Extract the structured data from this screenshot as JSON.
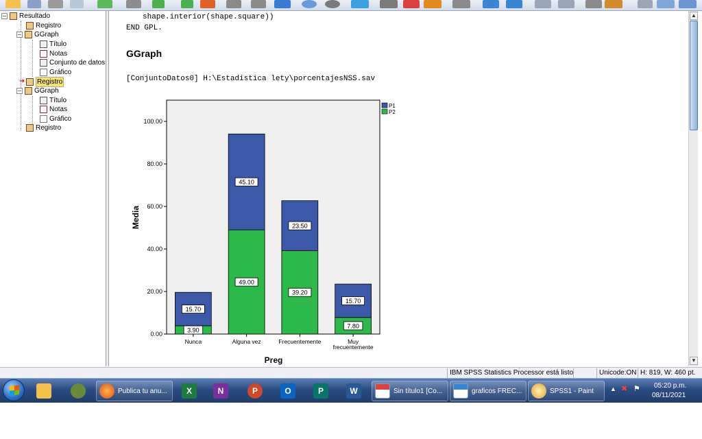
{
  "tree": {
    "items": [
      {
        "label": "Resultado",
        "icon": "output-book-icon",
        "expander": "−"
      },
      {
        "label": "Registro",
        "icon": "log-icon"
      },
      {
        "label": "GGraph",
        "icon": "ggraph-book-icon",
        "expander": "−"
      },
      {
        "label": "Título",
        "icon": "title-icon"
      },
      {
        "label": "Notas",
        "icon": "notes-icon"
      },
      {
        "label": "Conjunto de datos",
        "icon": "dataset-icon"
      },
      {
        "label": "Gráfico",
        "icon": "chart-icon"
      },
      {
        "label": "Registro",
        "icon": "log-icon",
        "selected": true
      },
      {
        "label": "GGraph",
        "icon": "ggraph-book-icon",
        "expander": "−"
      },
      {
        "label": "Título",
        "icon": "title-icon"
      },
      {
        "label": "Notas",
        "icon": "notes-icon"
      },
      {
        "label": "Gráfico",
        "icon": "chart-icon"
      },
      {
        "label": "Registro",
        "icon": "log-icon"
      }
    ]
  },
  "content": {
    "code_line1": "shape.interior(shape.square))",
    "code_line2": "END GPL.",
    "heading": "GGraph",
    "dataset_line": "[ConjuntoDatos0] H:\\Estadistica lety\\porcentajesNSS.sav"
  },
  "chart_data": {
    "type": "bar",
    "stacked": true,
    "categories": [
      "Nunca",
      "Alguna vez",
      "Frecuentemente",
      "Muy frecuentemente"
    ],
    "category_labels": [
      [
        "Nunca"
      ],
      [
        "Alguna vez"
      ],
      [
        "Frecuentemente"
      ],
      [
        "Muy",
        "frecuentemente"
      ]
    ],
    "series": [
      {
        "name": "P2",
        "values": [
          3.9,
          49.0,
          39.2,
          7.8
        ],
        "labels": [
          "3.90",
          "49.00",
          "39.20",
          "7.80"
        ],
        "color": "#2db84a"
      },
      {
        "name": "P1",
        "values": [
          15.7,
          45.1,
          23.5,
          15.7
        ],
        "labels": [
          "15.70",
          "45.10",
          "23.50",
          "15.70"
        ],
        "color": "#3c58a8"
      }
    ],
    "legend": [
      "P1",
      "P2"
    ],
    "legend_colors": [
      "#3c58a8",
      "#2db84a"
    ],
    "legend_placement": "top-right",
    "xlabel": "Preg",
    "ylabel": "Media",
    "ylim": [
      0,
      110
    ],
    "yticks": [
      0,
      20,
      40,
      60,
      80,
      100
    ],
    "ytick_labels": [
      "0.00",
      "20.00",
      "40.00",
      "60.00",
      "80.00",
      "100.00"
    ],
    "grid": false,
    "plot_background": "#efefef"
  },
  "status": {
    "processor": "IBM SPSS Statistics Processor está listo",
    "unicode": "Unicode:ON",
    "dims": "H: 819, W: 460 pt."
  },
  "taskbar": {
    "items": [
      {
        "label": "",
        "icon": "explorer-icon"
      },
      {
        "label": "",
        "icon": "media-icon"
      },
      {
        "label": "Publica tu anu...",
        "icon": "firefox-icon"
      },
      {
        "label": "",
        "icon": "excel-icon",
        "letter": "X"
      },
      {
        "label": "",
        "icon": "onenote-icon",
        "letter": "N"
      },
      {
        "label": "",
        "icon": "powerpoint-icon",
        "letter": "P"
      },
      {
        "label": "",
        "icon": "outlook-icon",
        "letter": "O"
      },
      {
        "label": "",
        "icon": "publisher-icon",
        "letter": "P"
      },
      {
        "label": "",
        "icon": "word-icon",
        "letter": "W"
      },
      {
        "label": "Sin título1 [Co...",
        "icon": "spss-data-icon"
      },
      {
        "label": "graficos FREC...",
        "icon": "spss-output-icon"
      },
      {
        "label": "SPSS1 - Paint",
        "icon": "paint-icon"
      }
    ],
    "time": "05:20 p.m.",
    "date": "08/11/2021"
  },
  "colors": {
    "p1": "#3c58a8",
    "p2": "#2db84a",
    "taskbar": "#2b4c82",
    "selection": "#f7e27a"
  }
}
